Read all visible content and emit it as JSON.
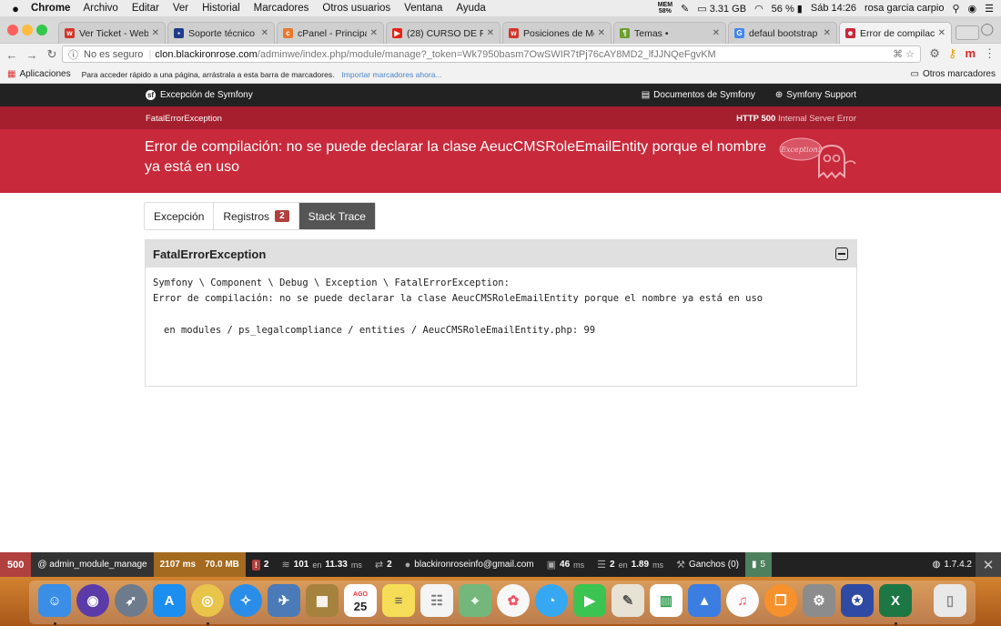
{
  "menubar": {
    "app": "Chrome",
    "items": [
      "Archivo",
      "Editar",
      "Ver",
      "Historial",
      "Marcadores",
      "Otros usuarios",
      "Ventana",
      "Ayuda"
    ],
    "mem_label": "MEM",
    "mem_value": "58%",
    "disk": "3.31 GB",
    "battery": "56 %",
    "clock": "Sáb 14:26",
    "user": "rosa garcia carpio"
  },
  "tabs": [
    {
      "title": "Ver Ticket - Webe",
      "fav": "w",
      "color": "#d3352b"
    },
    {
      "title": "Soporte técnico -",
      "fav": "▪",
      "color": "#1f3c88"
    },
    {
      "title": "cPanel - Principal",
      "fav": "c",
      "color": "#e8782b"
    },
    {
      "title": "(28) CURSO DE PR",
      "fav": "▶",
      "color": "#e62117"
    },
    {
      "title": "Posiciones de Mod",
      "fav": "w",
      "color": "#d3352b"
    },
    {
      "title": "Temas •",
      "fav": "¶",
      "color": "#6a9f2d"
    },
    {
      "title": "defaul bootstrap e",
      "fav": "G",
      "color": "#4285f4"
    },
    {
      "title": "Error de compilació",
      "fav": "☻",
      "color": "#c8293b"
    }
  ],
  "address": {
    "security": "No es seguro",
    "host": "clon.blackironrose.com",
    "path": "/adminwe/index.php/module/manage?_token=Wk7950basm7OwSWIR7tPj76cAY8MD2_lfJJNQeFgvKM"
  },
  "bookmarks": {
    "apps": "Aplicaciones",
    "hint": "Para acceder rápido a una página, arrástrala a esta barra de marcadores.",
    "import": "Importar marcadores ahora...",
    "other": "Otros marcadores"
  },
  "symfony": {
    "brand": "Excepción de Symfony",
    "docs": "Documentos de Symfony",
    "support": "Symfony Support",
    "exception_class": "FatalErrorException",
    "http_code": "HTTP 500",
    "http_text": "Internal Server Error",
    "message": "Error de compilación: no se puede declarar la clase AeucCMSRoleEmailEntity porque el nombre ya está en uso",
    "ghost_label": "Exception!"
  },
  "tabs_panel": {
    "exception": "Excepción",
    "logs": "Registros",
    "logs_count": "2",
    "trace": "Stack Trace"
  },
  "trace": {
    "header": "FatalErrorException",
    "line1": "Symfony \\ Component \\ Debug \\ Exception \\ FatalErrorException:",
    "line2": "Error de compilación: no se puede declarar la clase AeucCMSRoleEmailEntity porque el nombre ya está en uso",
    "location": "en modules / ps_legalcompliance / entities / AeucCMSRoleEmailEntity.php: 99"
  },
  "profiler": {
    "status": "500",
    "route": "@ admin_module_manage",
    "time": "2107 ms",
    "memory": "70.0 MB",
    "errors": "2",
    "queries": "101",
    "queries_suffix": "en",
    "queries_time": "11.33",
    "queries_unit": "ms",
    "translations": "2",
    "user": "blackironroseinfo@gmail.com",
    "twig": "46",
    "twig_unit": "ms",
    "cache": "2",
    "cache_suffix": "en",
    "cache_time": "1.89",
    "cache_unit": "ms",
    "hooks": "Ganchos (0)",
    "modules": "5",
    "version": "1.7.4.2"
  },
  "dock": {
    "calendar_month": "AGO",
    "calendar_day": "25"
  },
  "colors": {
    "symfony_red": "#c8293b",
    "symfony_dark_red": "#a51f2e",
    "profiler_bg": "#222222",
    "error_badge": "#b0413e"
  }
}
